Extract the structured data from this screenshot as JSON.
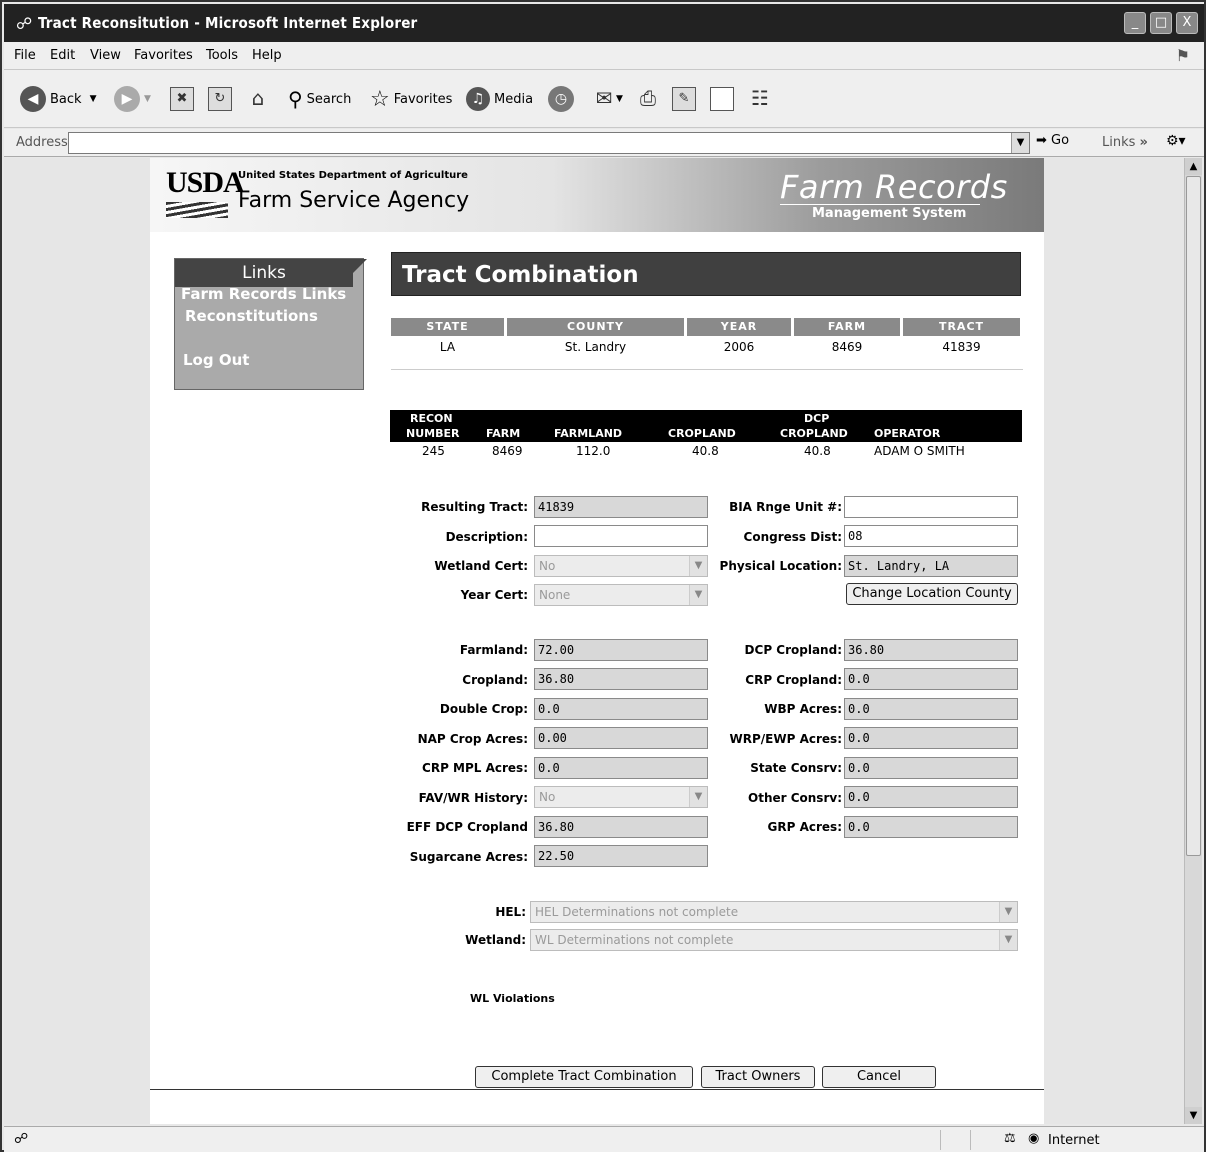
{
  "window": {
    "title": "Tract Reconsitution - Microsoft Internet Explorer",
    "controls": [
      "_",
      "□",
      "X"
    ]
  },
  "menu": [
    "File",
    "Edit",
    "View",
    "Favorites",
    "Tools",
    "Help"
  ],
  "toolbar": {
    "back": "Back",
    "search": "Search",
    "favorites": "Favorites",
    "media": "Media"
  },
  "address": {
    "label": "Address",
    "value": "",
    "go": "Go",
    "links": "Links"
  },
  "banner": {
    "usda": "USDA",
    "dept": "United States Department of Agriculture",
    "agency": "Farm Service Agency",
    "product": "Farm Records",
    "subtitle": "Management System"
  },
  "links_panel": {
    "heading": "Links",
    "items": [
      "Farm Records Links",
      "Reconstitutions",
      "Log Out"
    ]
  },
  "main": {
    "title": "Tract Combination",
    "location": {
      "headers": [
        "STATE",
        "COUNTY",
        "YEAR",
        "FARM",
        "TRACT"
      ],
      "values": [
        "LA",
        "St. Landry",
        "2006",
        "8469",
        "41839"
      ]
    },
    "recon": {
      "headers": {
        "recon_top": "RECON",
        "recon_bottom": "NUMBER",
        "farm": "FARM",
        "farmland": "FARMLAND",
        "cropland": "CROPLAND",
        "dcp_top": "DCP",
        "dcp_bottom": "CROPLAND",
        "operator": "OPERATOR"
      },
      "row": {
        "recon": "245",
        "farm": "8469",
        "farmland": "112.0",
        "cropland": "40.8",
        "dcp": "40.8",
        "operator": "ADAM O SMITH"
      }
    },
    "fields_left_top": [
      {
        "label": "Resulting Tract:",
        "value": "41839",
        "kind": "input-gray"
      },
      {
        "label": "Description:",
        "value": "",
        "kind": "input-white"
      },
      {
        "label": "Wetland Cert:",
        "value": "No",
        "kind": "select"
      },
      {
        "label": "Year Cert:",
        "value": "None",
        "kind": "select"
      }
    ],
    "fields_right_top": [
      {
        "label": "BIA Rnge Unit #:",
        "value": "",
        "kind": "input-white"
      },
      {
        "label": "Congress Dist:",
        "value": "08",
        "kind": "input-white"
      },
      {
        "label": "Physical Location:",
        "value": "St. Landry, LA",
        "kind": "input-gray"
      }
    ],
    "change_county_button": "Change Location County",
    "fields_left": [
      {
        "label": "Farmland:",
        "value": "72.00",
        "kind": "input-gray"
      },
      {
        "label": "Cropland:",
        "value": "36.80",
        "kind": "input-gray"
      },
      {
        "label": "Double Crop:",
        "value": "0.0",
        "kind": "input-gray"
      },
      {
        "label": "NAP Crop Acres:",
        "value": "0.00",
        "kind": "input-gray"
      },
      {
        "label": "CRP MPL Acres:",
        "value": "0.0",
        "kind": "input-gray"
      },
      {
        "label": "FAV/WR History:",
        "value": "No",
        "kind": "select"
      },
      {
        "label": "EFF DCP Cropland",
        "value": "36.80",
        "kind": "input-gray"
      },
      {
        "label": "Sugarcane Acres:",
        "value": "22.50",
        "kind": "input-gray"
      }
    ],
    "fields_right": [
      {
        "label": "DCP Cropland:",
        "value": "36.80"
      },
      {
        "label": "CRP Cropland:",
        "value": "0.0"
      },
      {
        "label": "WBP Acres:",
        "value": "0.0"
      },
      {
        "label": "WRP/EWP Acres:",
        "value": "0.0"
      },
      {
        "label": "State Consrv:",
        "value": "0.0"
      },
      {
        "label": "Other Consrv:",
        "value": "0.0"
      },
      {
        "label": "GRP Acres:",
        "value": "0.0"
      }
    ],
    "hel": {
      "label": "HEL:",
      "value": "HEL Determinations not complete"
    },
    "wetland": {
      "label": "Wetland:",
      "value": "WL Determinations not complete"
    },
    "wl_violations": "WL Violations",
    "buttons": {
      "complete": "Complete Tract Combination",
      "owners": "Tract Owners",
      "cancel": "Cancel"
    }
  },
  "status": {
    "zone": "Internet"
  }
}
